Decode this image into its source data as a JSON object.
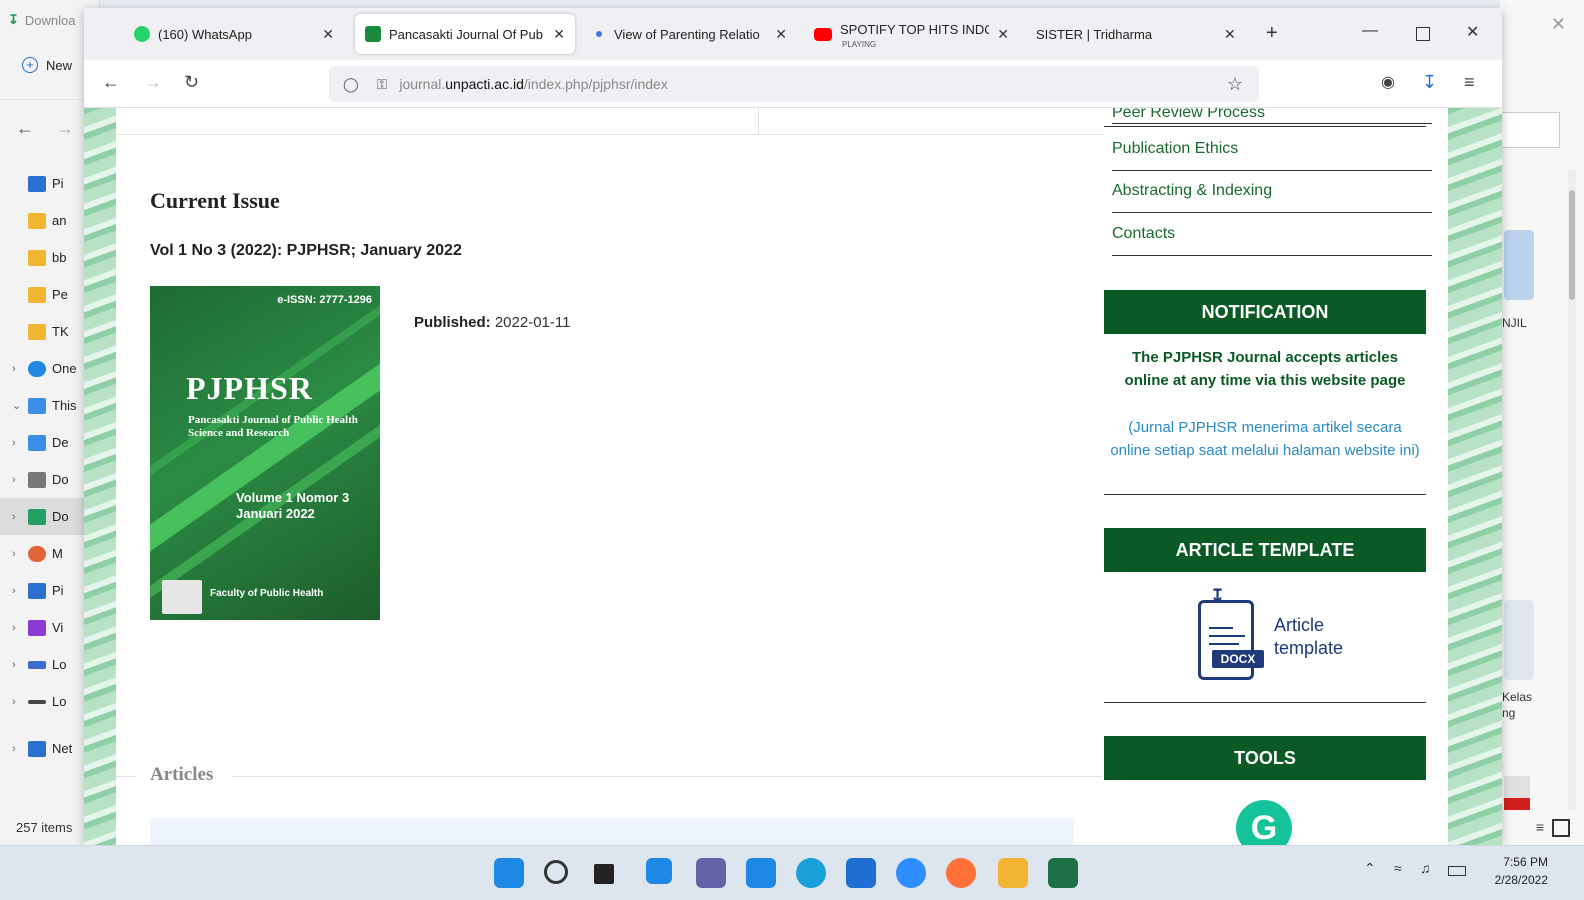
{
  "explorer": {
    "downloads_label": "Downloa",
    "new_label": "New",
    "items": [
      {
        "label": "Pi",
        "color": "#2b6fd1"
      },
      {
        "label": "an",
        "color": "#f2b531"
      },
      {
        "label": "bb",
        "color": "#f2b531"
      },
      {
        "label": "Pe",
        "color": "#f2b531"
      },
      {
        "label": "TK",
        "color": "#f2b531"
      },
      {
        "label": "One",
        "color": "#1e88e5"
      },
      {
        "label": "This",
        "color": "#3a8ee6"
      },
      {
        "label": "De",
        "color": "#3a8ee6"
      },
      {
        "label": "Do",
        "color": "#777777"
      },
      {
        "label": "Do",
        "color": "#22a064"
      },
      {
        "label": "M",
        "color": "#e2653a"
      },
      {
        "label": "Pi",
        "color": "#2b6fd1"
      },
      {
        "label": "Vi",
        "color": "#8b3ad6"
      },
      {
        "label": "Lo",
        "color": "#3a6fd1"
      },
      {
        "label": "Lo",
        "color": "#444444"
      },
      {
        "label": "Net",
        "color": "#2b6fd1"
      }
    ],
    "count": "257 items"
  },
  "right_window": {
    "label1": "NJIL",
    "label2": "Kelas",
    "label3": "ng"
  },
  "browser": {
    "tabs": [
      {
        "title": "(160) WhatsApp",
        "icon_color": "#25d366"
      },
      {
        "title": "Pancasakti Journal Of Pub",
        "icon_color": "#1a8a3c"
      },
      {
        "title": "View of Parenting Relatio",
        "icon_color": "#3b7be0"
      },
      {
        "title": "SPOTIFY TOP HITS INDONI",
        "sub": "PLAYING",
        "icon_color": "#ff0000"
      },
      {
        "title": "SISTER | Tridharma",
        "icon_color": "#f0f0f4"
      }
    ],
    "url_prefix": "journal.",
    "url_domain": "unpacti.ac.id",
    "url_path": "/index.php/pjphsr/index"
  },
  "page": {
    "current_issue": "Current Issue",
    "issue_title": "Vol 1 No 3 (2022): PJPHSR; January 2022",
    "cover": {
      "issn": "e-ISSN: 2777-1296",
      "logo": "PJPHSR",
      "journal_name": "Pancasakti Journal of Public Health Science and Research",
      "volume": "Volume 1 Nomor 3",
      "month": "Januari 2022",
      "published_by": "Faculty of Public Health"
    },
    "published_label": "Published:",
    "published_date": "2022-01-11",
    "articles_label": "Articles"
  },
  "sidebar": {
    "cut_link": "Peer Review Process",
    "links": [
      "Publication Ethics",
      "Abstracting & Indexing",
      "Contacts"
    ],
    "notification_head": "NOTIFICATION",
    "notification_text": "The PJPHSR Journal accepts articles online at any time via this website page",
    "notification_sub": "(Jurnal PJPHSR menerima artikel secara online setiap saat melalui halaman website ini)",
    "template_head": "ARTICLE TEMPLATE",
    "template_tag": "DOCX",
    "template_label_1": "Article",
    "template_label_2": "template",
    "tools_head": "TOOLS",
    "grammarly_glyph": "G"
  },
  "taskbar": {
    "time": "7:56 PM",
    "date": "2/28/2022",
    "icons": [
      {
        "name": "start",
        "color": "#1e88e5"
      },
      {
        "name": "search",
        "color": "#333333"
      },
      {
        "name": "task-view",
        "color": "#222222"
      },
      {
        "name": "widgets",
        "color": "#1e88e5"
      },
      {
        "name": "teams-chat",
        "color": "#6264a7"
      },
      {
        "name": "store",
        "color": "#1e88e5"
      },
      {
        "name": "edge",
        "color": "#1aa0d8"
      },
      {
        "name": "mail",
        "color": "#1e6fd1"
      },
      {
        "name": "zoom",
        "color": "#2d8cff"
      },
      {
        "name": "firefox",
        "color": "#ff7139"
      },
      {
        "name": "file-explorer",
        "color": "#f2b531"
      },
      {
        "name": "excel",
        "color": "#1d7044"
      }
    ]
  }
}
